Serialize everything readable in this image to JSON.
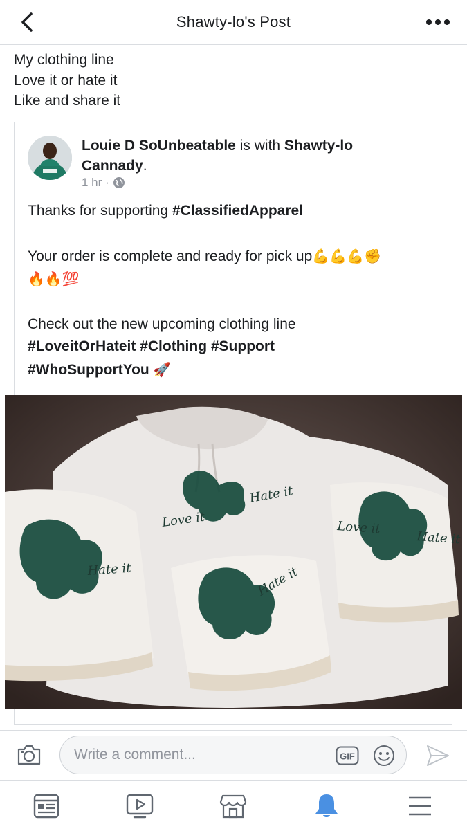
{
  "header": {
    "title": "Shawty-lo's Post",
    "back_icon": "chevron-left-icon",
    "more_icon": "more-horizontal-icon"
  },
  "post": {
    "lines": [
      "My clothing line",
      "Love it or hate it",
      "Like and share it"
    ]
  },
  "shared_post": {
    "author": "Louie D SoUnbeatable",
    "with_text": " is with ",
    "tagged_line1": "Shawty-lo",
    "tagged_line2": "Cannady",
    "period": ".",
    "time": "1 hr",
    "dot": "·",
    "privacy_icon": "globe-icon",
    "thanks_prefix": "Thanks for supporting ",
    "thanks_tag": "#ClassifiedApparel",
    "order_text": "Your order is complete and ready for pick up",
    "order_emojis": "💪💪💪✊",
    "fire_emojis": "🔥🔥💯",
    "check_text": "Check out the new upcoming clothing line",
    "tags_line1": "#LoveitOrHateit #Clothing #Support",
    "tags_line2": "#WhoSupportYou",
    "rocket_emoji": "🚀",
    "photo_script_1": "Love it",
    "photo_script_2": "Hate it"
  },
  "comment_bar": {
    "placeholder": "Write a comment...",
    "gif_label": "GIF"
  },
  "tabs": [
    {
      "icon": "news-feed-icon"
    },
    {
      "icon": "watch-video-icon"
    },
    {
      "icon": "marketplace-icon"
    },
    {
      "icon": "notifications-bell-icon"
    },
    {
      "icon": "menu-icon"
    }
  ],
  "colors": {
    "active_tab": "#4a90e2",
    "icon_gray": "#606770",
    "text_dark": "#1c1e21",
    "meta_gray": "#90949c",
    "divider": "#dadde1"
  }
}
